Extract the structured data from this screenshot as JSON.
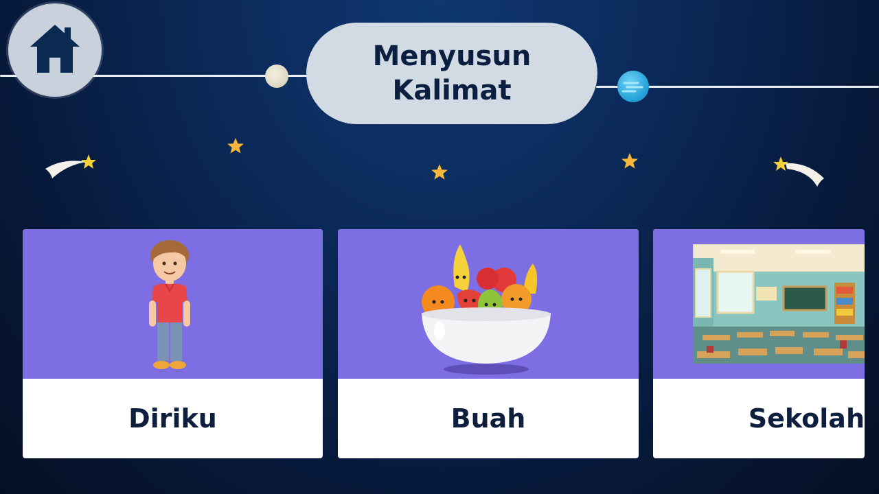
{
  "header": {
    "title": "Menyusun\nKalimat",
    "home_icon": "home-icon"
  },
  "colors": {
    "background": "#0b2a5a",
    "card_top": "#7d6ee3",
    "card_bottom": "#ffffff",
    "title_pill": "#d2dae4",
    "text_dark": "#0d1f3c",
    "star": "#f5b63a"
  },
  "cards": [
    {
      "label": "Diriku",
      "icon": "boy-illustration"
    },
    {
      "label": "Buah",
      "icon": "fruit-bowl-illustration"
    },
    {
      "label": "Sekolah",
      "icon": "classroom-illustration"
    }
  ]
}
